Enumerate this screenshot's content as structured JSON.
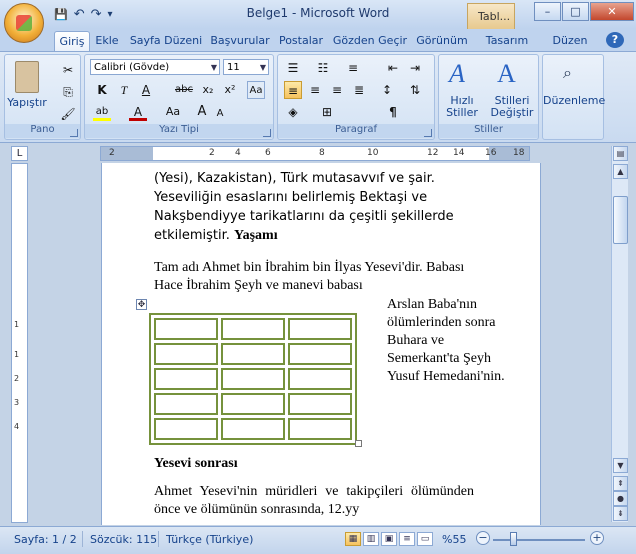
{
  "window": {
    "title": "Belge1 - Microsoft Word",
    "context_tab": "Tabl...",
    "buttons": {
      "minimize": "–",
      "maximize": "□",
      "close": "✕"
    }
  },
  "qat": {
    "save": "💾",
    "undo": "↶",
    "redo": "↷",
    "more": "▾"
  },
  "tabs": [
    "Giriş",
    "Ekle",
    "Sayfa Düzeni",
    "Başvurular",
    "Postalar",
    "Gözden Geçir",
    "Görünüm",
    "Tasarım",
    "Düzen"
  ],
  "active_tab": "Giriş",
  "help": "?",
  "ribbon": {
    "clipboard": {
      "label": "Pano",
      "paste": "Yapıştır"
    },
    "font": {
      "label": "Yazı Tipi",
      "font_name": "Calibri (Gövde)",
      "font_size": "11",
      "bold": "K",
      "italic": "T",
      "underline": "A",
      "strike": "abc",
      "subscript": "x₂",
      "superscript": "x²",
      "grow": "A",
      "shrink": "A",
      "case": "Aa",
      "color": "A",
      "highlight": "ab"
    },
    "paragraph": {
      "label": "Paragraf",
      "pilcrow": "¶"
    },
    "styles": {
      "label": "Stiller",
      "quick": "Hızlı Stiller",
      "change": "Stilleri Değiştir"
    },
    "editing": {
      "label": "Düzenleme"
    }
  },
  "ruler": {
    "corner": "L",
    "h_ticks": [
      "2",
      "2",
      "4",
      "6",
      "8",
      "10",
      "12",
      "14",
      "16",
      "18"
    ],
    "v_ticks": [
      "1",
      "1",
      "2",
      "3",
      "4"
    ]
  },
  "document": {
    "p1_a": "(Yesi), Kazakistan), Türk mutasavvıf ve şair. Yeseviliğin esaslarını belirlemiş Bektaşi ve Nakşbendiyye tarikatlarını da çeşitli şekillerde etkilemiştir. ",
    "p1_bold": "Yaşamı",
    "p2": "Tam adı Ahmet bin İbrahim bin İlyas Yesevi'dir. Babası Hace İbrahim Şeyh ve manevi babası",
    "p3": "Arslan Baba'nın ölümlerinden sonra Buhara ve Semerkant'ta Şeyh Yusuf Hemedani'nin.",
    "heading": "Yesevi sonrası",
    "p4": "Ahmet Yesevi'nin müridleri ve takipçileri ölümünden önce ve ölümünün sonrasında, 12.yy",
    "table_rows": 5,
    "table_cols": 3,
    "table_border_color": "#76923c"
  },
  "status": {
    "page": "Sayfa: 1 / 2",
    "words": "Sözcük: 115",
    "language": "Türkçe (Türkiye)",
    "zoom": "%55",
    "zoom_minus": "−",
    "zoom_plus": "+"
  },
  "accent": "#15428b"
}
